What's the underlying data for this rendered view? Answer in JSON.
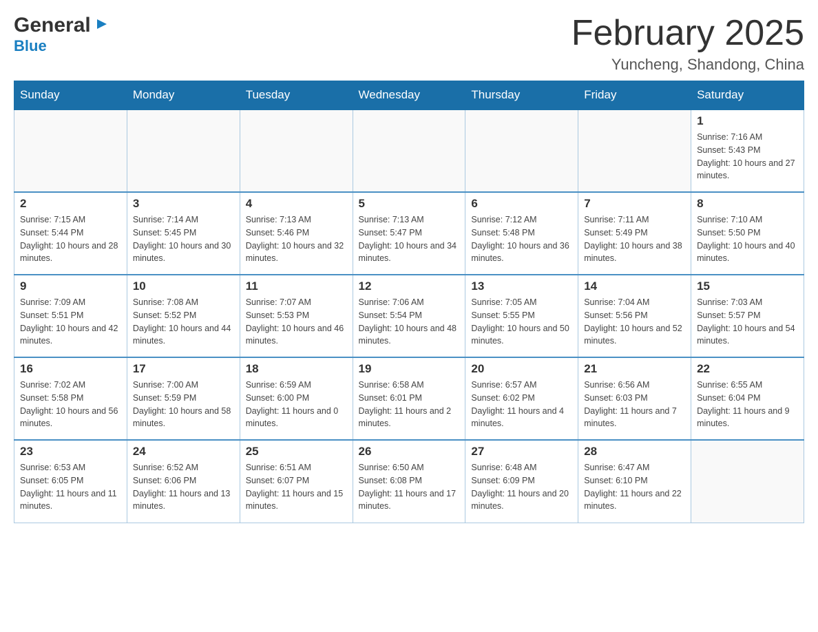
{
  "header": {
    "logo_general": "General",
    "logo_blue": "Blue",
    "month_title": "February 2025",
    "location": "Yuncheng, Shandong, China"
  },
  "weekdays": [
    "Sunday",
    "Monday",
    "Tuesday",
    "Wednesday",
    "Thursday",
    "Friday",
    "Saturday"
  ],
  "weeks": [
    [
      {
        "day": "",
        "info": ""
      },
      {
        "day": "",
        "info": ""
      },
      {
        "day": "",
        "info": ""
      },
      {
        "day": "",
        "info": ""
      },
      {
        "day": "",
        "info": ""
      },
      {
        "day": "",
        "info": ""
      },
      {
        "day": "1",
        "info": "Sunrise: 7:16 AM\nSunset: 5:43 PM\nDaylight: 10 hours and 27 minutes."
      }
    ],
    [
      {
        "day": "2",
        "info": "Sunrise: 7:15 AM\nSunset: 5:44 PM\nDaylight: 10 hours and 28 minutes."
      },
      {
        "day": "3",
        "info": "Sunrise: 7:14 AM\nSunset: 5:45 PM\nDaylight: 10 hours and 30 minutes."
      },
      {
        "day": "4",
        "info": "Sunrise: 7:13 AM\nSunset: 5:46 PM\nDaylight: 10 hours and 32 minutes."
      },
      {
        "day": "5",
        "info": "Sunrise: 7:13 AM\nSunset: 5:47 PM\nDaylight: 10 hours and 34 minutes."
      },
      {
        "day": "6",
        "info": "Sunrise: 7:12 AM\nSunset: 5:48 PM\nDaylight: 10 hours and 36 minutes."
      },
      {
        "day": "7",
        "info": "Sunrise: 7:11 AM\nSunset: 5:49 PM\nDaylight: 10 hours and 38 minutes."
      },
      {
        "day": "8",
        "info": "Sunrise: 7:10 AM\nSunset: 5:50 PM\nDaylight: 10 hours and 40 minutes."
      }
    ],
    [
      {
        "day": "9",
        "info": "Sunrise: 7:09 AM\nSunset: 5:51 PM\nDaylight: 10 hours and 42 minutes."
      },
      {
        "day": "10",
        "info": "Sunrise: 7:08 AM\nSunset: 5:52 PM\nDaylight: 10 hours and 44 minutes."
      },
      {
        "day": "11",
        "info": "Sunrise: 7:07 AM\nSunset: 5:53 PM\nDaylight: 10 hours and 46 minutes."
      },
      {
        "day": "12",
        "info": "Sunrise: 7:06 AM\nSunset: 5:54 PM\nDaylight: 10 hours and 48 minutes."
      },
      {
        "day": "13",
        "info": "Sunrise: 7:05 AM\nSunset: 5:55 PM\nDaylight: 10 hours and 50 minutes."
      },
      {
        "day": "14",
        "info": "Sunrise: 7:04 AM\nSunset: 5:56 PM\nDaylight: 10 hours and 52 minutes."
      },
      {
        "day": "15",
        "info": "Sunrise: 7:03 AM\nSunset: 5:57 PM\nDaylight: 10 hours and 54 minutes."
      }
    ],
    [
      {
        "day": "16",
        "info": "Sunrise: 7:02 AM\nSunset: 5:58 PM\nDaylight: 10 hours and 56 minutes."
      },
      {
        "day": "17",
        "info": "Sunrise: 7:00 AM\nSunset: 5:59 PM\nDaylight: 10 hours and 58 minutes."
      },
      {
        "day": "18",
        "info": "Sunrise: 6:59 AM\nSunset: 6:00 PM\nDaylight: 11 hours and 0 minutes."
      },
      {
        "day": "19",
        "info": "Sunrise: 6:58 AM\nSunset: 6:01 PM\nDaylight: 11 hours and 2 minutes."
      },
      {
        "day": "20",
        "info": "Sunrise: 6:57 AM\nSunset: 6:02 PM\nDaylight: 11 hours and 4 minutes."
      },
      {
        "day": "21",
        "info": "Sunrise: 6:56 AM\nSunset: 6:03 PM\nDaylight: 11 hours and 7 minutes."
      },
      {
        "day": "22",
        "info": "Sunrise: 6:55 AM\nSunset: 6:04 PM\nDaylight: 11 hours and 9 minutes."
      }
    ],
    [
      {
        "day": "23",
        "info": "Sunrise: 6:53 AM\nSunset: 6:05 PM\nDaylight: 11 hours and 11 minutes."
      },
      {
        "day": "24",
        "info": "Sunrise: 6:52 AM\nSunset: 6:06 PM\nDaylight: 11 hours and 13 minutes."
      },
      {
        "day": "25",
        "info": "Sunrise: 6:51 AM\nSunset: 6:07 PM\nDaylight: 11 hours and 15 minutes."
      },
      {
        "day": "26",
        "info": "Sunrise: 6:50 AM\nSunset: 6:08 PM\nDaylight: 11 hours and 17 minutes."
      },
      {
        "day": "27",
        "info": "Sunrise: 6:48 AM\nSunset: 6:09 PM\nDaylight: 11 hours and 20 minutes."
      },
      {
        "day": "28",
        "info": "Sunrise: 6:47 AM\nSunset: 6:10 PM\nDaylight: 11 hours and 22 minutes."
      },
      {
        "day": "",
        "info": ""
      }
    ]
  ]
}
